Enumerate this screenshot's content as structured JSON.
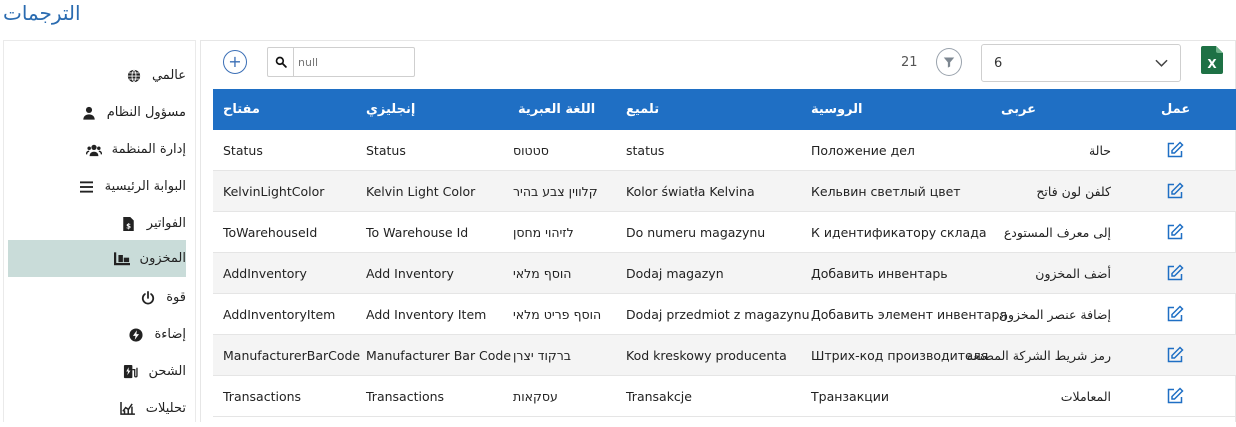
{
  "page": {
    "title": "الترجمات"
  },
  "sidebar": {
    "items": [
      {
        "label": "عالمي",
        "icon": "globe-icon"
      },
      {
        "label": "مسؤول النظام",
        "icon": "user-icon"
      },
      {
        "label": "إدارة المنظمة",
        "icon": "users-icon"
      },
      {
        "label": "البوابة الرئيسية",
        "icon": "bars-icon"
      },
      {
        "label": "الفواتير",
        "icon": "invoice-icon"
      },
      {
        "label": "المخزون",
        "icon": "warehouse-icon",
        "active": true
      },
      {
        "label": "قوة",
        "icon": "power-icon"
      },
      {
        "label": "إضاءة",
        "icon": "bolt-icon"
      },
      {
        "label": "الشحن",
        "icon": "charging-station-icon"
      },
      {
        "label": "تحليلات",
        "icon": "chart-icon"
      }
    ]
  },
  "toolbar": {
    "search_placeholder": "null",
    "count": "21",
    "select_value": "6"
  },
  "table": {
    "headers": {
      "key": "مفتاح",
      "english": "إنجليزي",
      "hebrew": "اللغة العبرية",
      "polish": "تلميع",
      "russian": "الروسية",
      "arabic": "عربى",
      "action": "عمل"
    },
    "rows": [
      {
        "key": "Status",
        "english": "Status",
        "hebrew": "סטטוס",
        "polish": "status",
        "russian": "Положение дел",
        "arabic": "حالة"
      },
      {
        "key": "KelvinLightColor",
        "english": "Kelvin Light Color",
        "hebrew": "קלווין צבע בהיר",
        "polish": "Kolor światła Kelvina",
        "russian": "Кельвин светлый цвет",
        "arabic": "كلفن لون فاتح"
      },
      {
        "key": "ToWarehouseId",
        "english": "To Warehouse Id",
        "hebrew": "לזיהוי מחסן",
        "polish": "Do numeru magazynu",
        "russian": "К идентификатору склада",
        "arabic": "إلى معرف المستودع"
      },
      {
        "key": "AddInventory",
        "english": "Add Inventory",
        "hebrew": "הוסף מלאי",
        "polish": "Dodaj magazyn",
        "russian": "Добавить инвентарь",
        "arabic": "أضف المخزون"
      },
      {
        "key": "AddInventoryItem",
        "english": "Add Inventory Item",
        "hebrew": "הוסף פריט מלאי",
        "polish": "Dodaj przedmiot z magazynu",
        "russian": "Добавить элемент инвентаря",
        "arabic": "إضافة عنصر المخزون"
      },
      {
        "key": "ManufacturerBarCode",
        "english": "Manufacturer Bar Code",
        "hebrew": "ברקוד יצרן",
        "polish": "Kod kreskowy producenta",
        "russian": "Штрих-код производителя",
        "arabic": "رمز شريط الشركة المصنعة"
      },
      {
        "key": "Transactions",
        "english": "Transactions",
        "hebrew": "עסקאות",
        "polish": "Transakcje",
        "russian": "Транзакции",
        "arabic": "المعاملات"
      }
    ]
  },
  "colors": {
    "accent": "#1f6fc4",
    "title": "#2a6bb0",
    "active": "#c9dcd9",
    "excel": "#1e7145"
  }
}
